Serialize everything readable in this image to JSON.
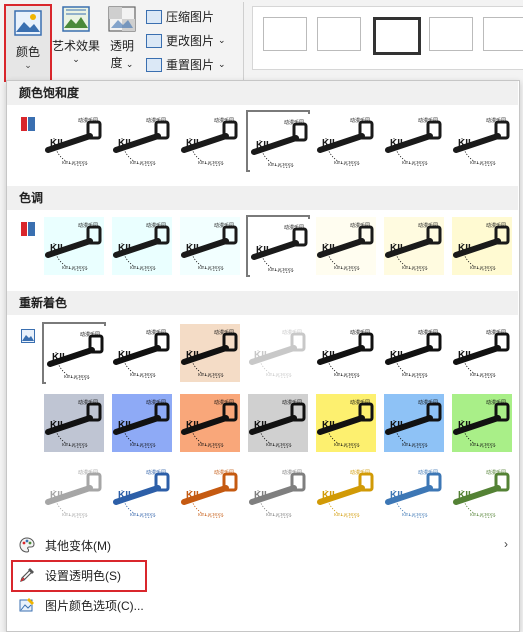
{
  "ribbon": {
    "color_button": {
      "label": "颜色",
      "chevron": "⌄"
    },
    "artistic_button": {
      "label": "艺术效果",
      "chevron": "⌄"
    },
    "transparency_button": {
      "label": "透明",
      "label2": "度",
      "chevron": "⌄"
    },
    "compress_label": "压缩图片",
    "change_label": "更改图片",
    "reset_label": "重置图片"
  },
  "sections": {
    "saturation": "颜色饱和度",
    "tone": "色调",
    "recolor": "重新着色"
  },
  "logo_text": {
    "top": "动漫乐园",
    "main": "KIL",
    "bottom": "KILL SCHOOL"
  },
  "recolor_tints": {
    "row1": [
      "#ffffff",
      "#ffffff",
      "#f4dcc6",
      "#ffffff",
      "#ffffff",
      "#ffffff",
      "#ffffff"
    ],
    "row2": [
      "#bfc5d3",
      "#8eaaf6",
      "#f9a77a",
      "#d0d0d0",
      "#fdf06f",
      "#8ec2f6",
      "#a9ef88"
    ],
    "row3_ink": [
      "#a6a6a6",
      "#2d5fa8",
      "#c55a11",
      "#7f7f7f",
      "#d19a06",
      "#3d77b5",
      "#548235"
    ]
  },
  "tone_tints": [
    "#eaffff",
    "#eaffff",
    "#f2ffff",
    "#ffffff",
    "#fffdf0",
    "#fffbe0",
    "#fffad2"
  ],
  "menu": {
    "more_variants": "其他变体(M)",
    "set_transparent": "设置透明色(S)",
    "color_options": "图片颜色选项(C)..."
  },
  "colors": {
    "accent_red": "#d9262c",
    "section_bg": "#f0f0f0"
  }
}
